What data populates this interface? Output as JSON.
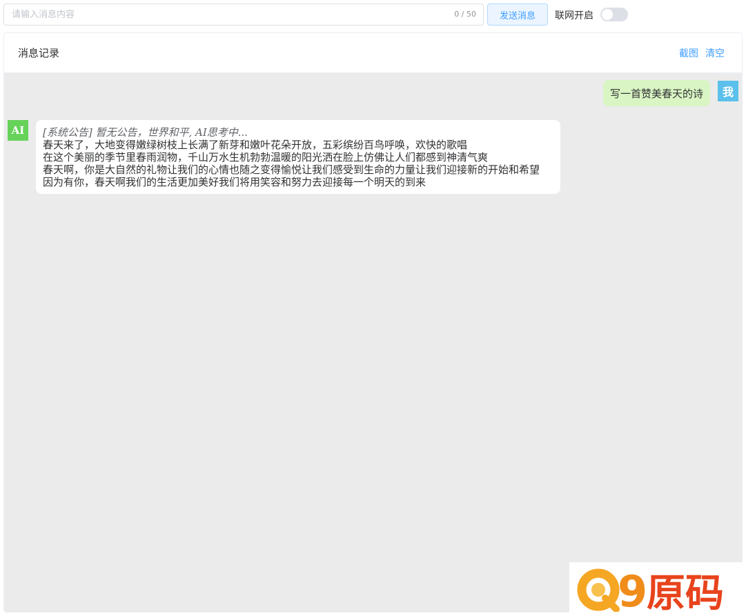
{
  "topbar": {
    "input_placeholder": "请输入消息内容",
    "input_value": "",
    "counter": "0 / 50",
    "send_label": "发送消息",
    "network_label": "联网开启",
    "network_on": false
  },
  "card": {
    "title": "消息记录",
    "screenshot_label": "截图",
    "clear_label": "清空"
  },
  "messages": {
    "user_avatar": "我",
    "user_text": "写一首赞美春天的诗",
    "ai_avatar": "AI",
    "ai_notice": "[系统公告] 暂无公告，世界和平, AI思考中...",
    "ai_lines": [
      "春天来了，大地变得嫩绿树枝上长满了新芽和嫩叶花朵开放，五彩缤纷百鸟呼唤，欢快的歌唱",
      "在这个美丽的季节里春雨润物，千山万水生机勃勃温暖的阳光洒在脸上仿佛让人们都感到神清气爽",
      "春天啊，你是大自然的礼物让我们的心情也随之变得愉悦让我们感受到生命的力量让我们迎接新的开始和希望",
      "因为有你，春天啊我们的生活更加美好我们将用笑容和努力去迎接每一个明天的到来"
    ]
  },
  "watermark": {
    "text": "Q9原码",
    "colors": {
      "q": "#f5a623",
      "nine": "#f08c1a",
      "text": "#e8431c"
    }
  },
  "colors": {
    "accent": "#409eff",
    "user_bubble": "#d9f5c3",
    "user_avatar": "#5bc0eb",
    "ai_avatar": "#67d25a",
    "chat_bg": "#ebebeb"
  }
}
